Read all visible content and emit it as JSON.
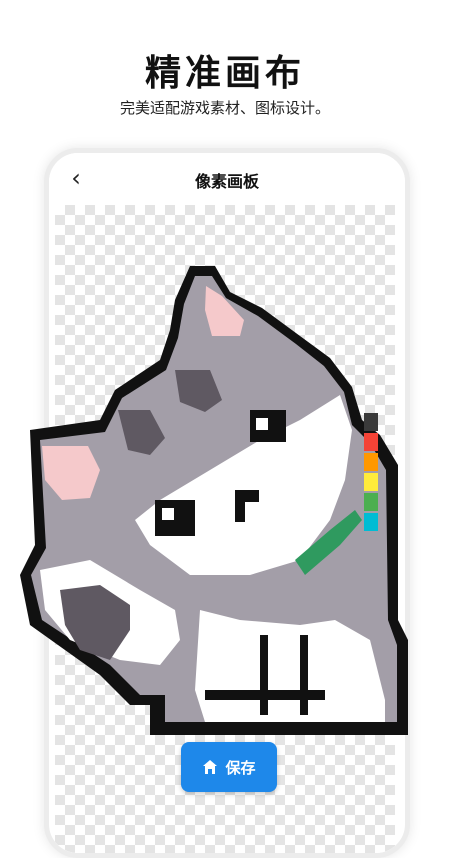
{
  "headline": "精准画布",
  "subline": "完美适配游戏素材、图标设计。",
  "screen": {
    "back_icon": "chevron-left-icon",
    "title": "像素画板"
  },
  "palette": {
    "colors": [
      "#3a3a3a",
      "#f44336",
      "#ff9800",
      "#ffeb3b",
      "#4caf50",
      "#00bcd4"
    ]
  },
  "save_button": {
    "label": "保存",
    "icon": "home-icon"
  },
  "artwork": {
    "subject": "pixel cat",
    "colors": {
      "outline": "#111111",
      "fur": "#a39ea8",
      "dark": "#5f5962",
      "ear": "#f5c9cb",
      "white": "#ffffff",
      "collar": "#2f9a5f"
    }
  }
}
